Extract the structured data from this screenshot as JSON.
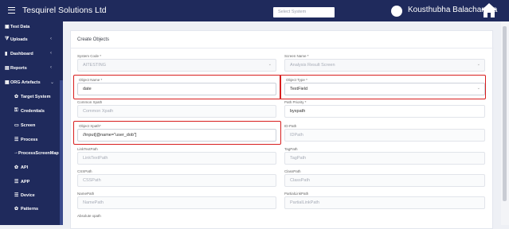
{
  "app": {
    "title": "Tesquirel Solutions Ltd",
    "system_select_placeholder": "Select System",
    "user_name": "Kousthubha Balachandra"
  },
  "sidebar": {
    "items": [
      {
        "icon": "briefcase-icon",
        "label": "Test Data",
        "chevron": ""
      },
      {
        "icon": "filter-icon",
        "label": "Uploads",
        "chevron": "‹"
      },
      {
        "icon": "bar-chart-icon",
        "label": "Dashboard",
        "chevron": "‹"
      },
      {
        "icon": "file-icon",
        "label": "Reports",
        "chevron": "‹"
      },
      {
        "icon": "sitemap-icon",
        "label": "ORG Artefacts",
        "chevron": "⌄"
      },
      {
        "icon": "gear-icon",
        "label": "Target System",
        "chevron": ""
      },
      {
        "icon": "key-icon",
        "label": "Credentials",
        "chevron": ""
      },
      {
        "icon": "monitor-icon",
        "label": "Screen",
        "chevron": ""
      },
      {
        "icon": "server-icon",
        "label": "Process",
        "chevron": ""
      },
      {
        "icon": "arrow-icon",
        "label": "ProcessScreenMap",
        "chevron": ""
      },
      {
        "icon": "gear-icon",
        "label": "API",
        "chevron": ""
      },
      {
        "icon": "server-icon",
        "label": "APP",
        "chevron": ""
      },
      {
        "icon": "server-icon",
        "label": "Device",
        "chevron": ""
      },
      {
        "icon": "gear-icon",
        "label": "Patterns",
        "chevron": ""
      }
    ]
  },
  "form": {
    "title": "Create Objects",
    "system_code": {
      "label": "System Code *",
      "value": "AITESTING"
    },
    "screen_name": {
      "label": "Screen Name *",
      "value": "Analysis Result Screen"
    },
    "object_name": {
      "label": "Object Name *",
      "value": "date"
    },
    "object_type": {
      "label": "Object Type *",
      "value": "TextField"
    },
    "common_xpath": {
      "label": "Common Xpath",
      "placeholder": "Common Xpath"
    },
    "path_priority": {
      "label": "Path Priority *",
      "value": "byxpath"
    },
    "object_xpath": {
      "label": "Object Xpath*",
      "value": "//input[@name=\"user_dob\"]"
    },
    "id_path": {
      "label": "ID-Path",
      "placeholder": "IDPath"
    },
    "link_text_path": {
      "label": "LinkTextPath",
      "placeholder": "LinkTextPath"
    },
    "tag_path": {
      "label": "TagPath",
      "placeholder": "TagPath"
    },
    "css_path": {
      "label": "CSSPath",
      "placeholder": "CSSPath"
    },
    "class_path": {
      "label": "ClassPath",
      "placeholder": "ClassPath"
    },
    "name_path": {
      "label": "NamePath",
      "placeholder": "NamePath"
    },
    "partial_link_path": {
      "label": "PartialLinkPath",
      "placeholder": "PartialLinkPath"
    },
    "absolute_xpath": {
      "label": "Absolute xpath"
    }
  },
  "colors": {
    "topbar": "#1f2a5c",
    "sidebar": "#1f2a5c",
    "highlight": "#d81e1e"
  }
}
